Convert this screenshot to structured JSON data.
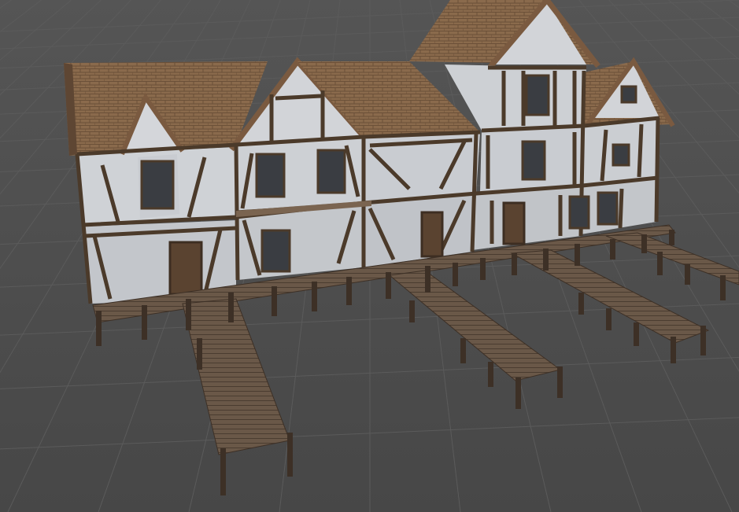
{
  "scene": {
    "background": "#4a4a4a",
    "grid_color": "#5a5a5a",
    "roof_color": "#8a6a4c",
    "plaster_color": "#c9ccd1",
    "timber_color": "#4b3a2a",
    "dock_color": "#6a5848",
    "post_color": "#3d3026"
  }
}
